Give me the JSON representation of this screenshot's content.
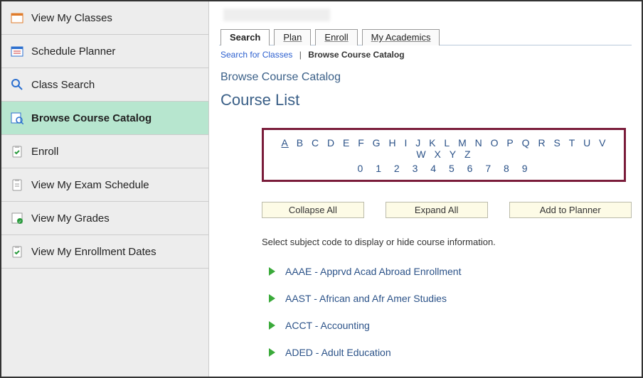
{
  "sidebar": {
    "items": [
      {
        "label": "View My Classes",
        "icon": "calendar"
      },
      {
        "label": "Schedule Planner",
        "icon": "planner"
      },
      {
        "label": "Class Search",
        "icon": "search"
      },
      {
        "label": "Browse Course Catalog",
        "icon": "catalog",
        "active": true
      },
      {
        "label": "Enroll",
        "icon": "clipboard-check"
      },
      {
        "label": "View My Exam Schedule",
        "icon": "clipboard"
      },
      {
        "label": "View My Grades",
        "icon": "grades"
      },
      {
        "label": "View My Enrollment Dates",
        "icon": "clipboard-check"
      }
    ]
  },
  "tabs": [
    {
      "label": "Search",
      "active": true
    },
    {
      "label": "Plan"
    },
    {
      "label": "Enroll"
    },
    {
      "label": "My Academics"
    }
  ],
  "breadcrumbs": {
    "link": "Search for Classes",
    "separator": "|",
    "current": "Browse Course Catalog"
  },
  "section_title": "Browse Course Catalog",
  "heading": "Course List",
  "alpha": {
    "letters": [
      "A",
      "B",
      "C",
      "D",
      "E",
      "F",
      "G",
      "H",
      "I",
      "J",
      "K",
      "L",
      "M",
      "N",
      "O",
      "P",
      "Q",
      "R",
      "S",
      "T",
      "U",
      "V",
      "W",
      "X",
      "Y",
      "Z"
    ],
    "digits": [
      "0",
      "1",
      "2",
      "3",
      "4",
      "5",
      "6",
      "7",
      "8",
      "9"
    ],
    "selected": "A"
  },
  "buttons": {
    "collapse": "Collapse All",
    "expand": "Expand All",
    "add": "Add to Planner"
  },
  "instruction": "Select subject code to display or hide course information.",
  "subjects": [
    "AAAE - Apprvd Acad Abroad Enrollment",
    "AAST - African and Afr Amer Studies",
    "ACCT - Accounting",
    "ADED - Adult Education"
  ]
}
